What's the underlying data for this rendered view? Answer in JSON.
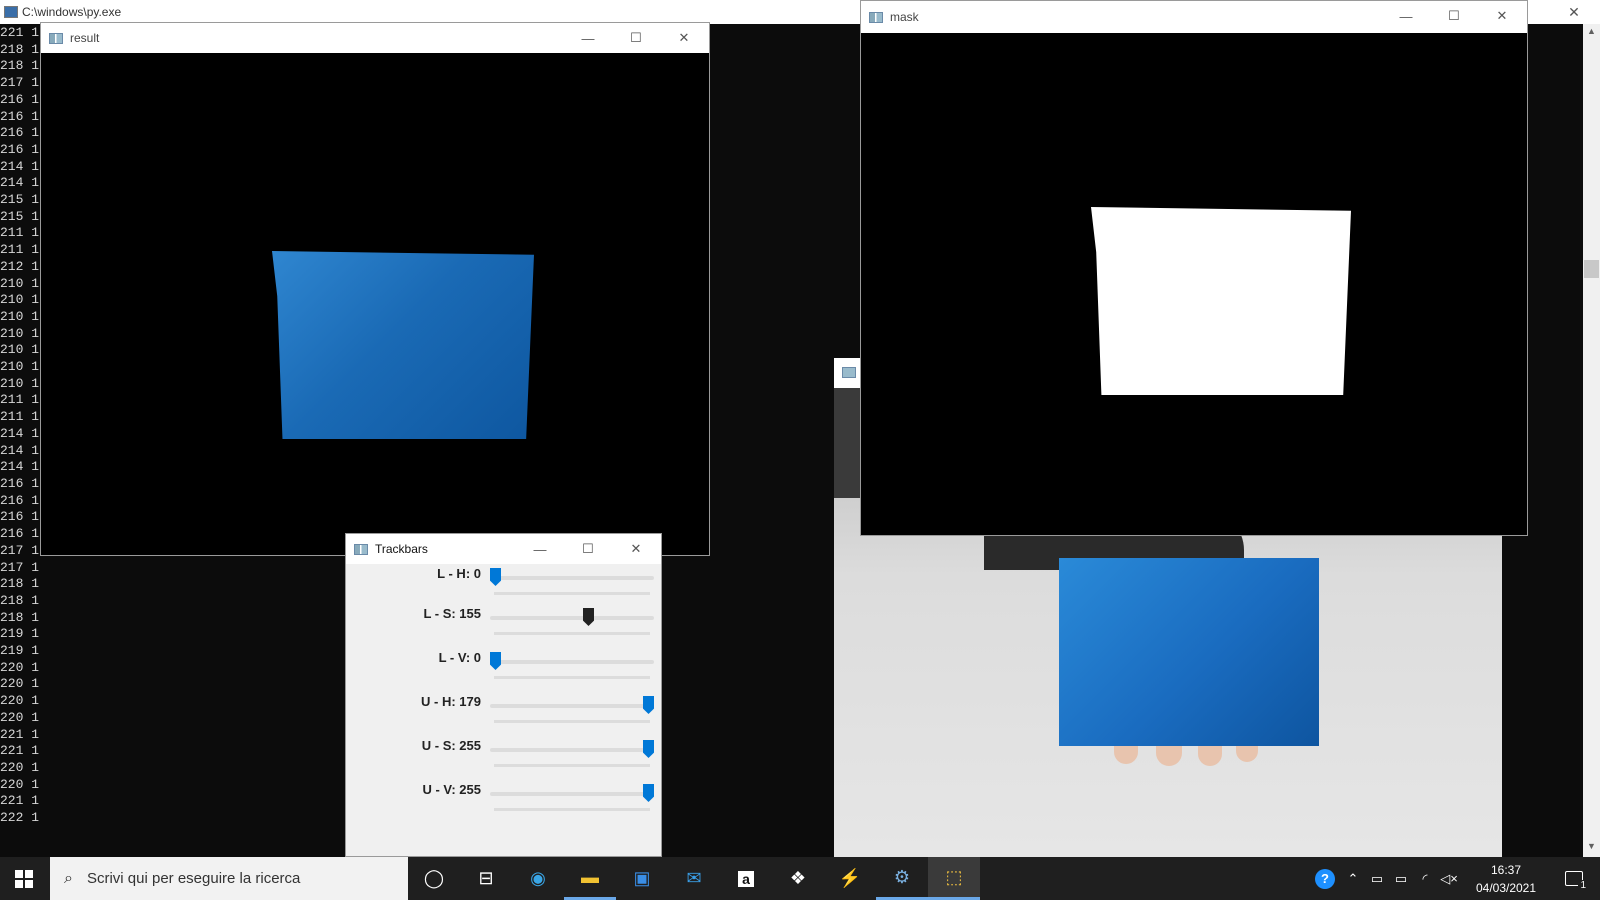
{
  "console": {
    "title": "C:\\windows\\py.exe",
    "close_glyph": "✕",
    "lines": [
      "221 1",
      "218 1",
      "218 1",
      "217 1",
      "216 1",
      "216 1",
      "216 1",
      "216 1",
      "214 1",
      "214 1",
      "215 1",
      "215 1",
      "211 1",
      "211 1",
      "212 1",
      "210 1",
      "210 1",
      "210 1",
      "210 1",
      "210 1",
      "210 1",
      "210 1",
      "211 1",
      "211 1",
      "214 1",
      "214 1",
      "214 1",
      "216 1",
      "216 1",
      "216 1",
      "216 1",
      "217 1",
      "217 1",
      "218 1",
      "218 1",
      "218 1",
      "219 1",
      "219 1",
      "220 1",
      "220 1",
      "220 1",
      "220 1",
      "221 1",
      "221 1",
      "220 1",
      "220 1",
      "221 1",
      "222 1"
    ]
  },
  "windows": {
    "result": {
      "title": "result"
    },
    "mask": {
      "title": "mask"
    },
    "trackbars": {
      "title": "Trackbars"
    }
  },
  "window_controls": {
    "minimize": "—",
    "maximize": "☐",
    "close": "✕"
  },
  "trackbars": [
    {
      "label": "L - H: 0",
      "value": 0,
      "max": 179
    },
    {
      "label": "L - S: 155",
      "value": 155,
      "max": 255
    },
    {
      "label": "L - V: 0",
      "value": 0,
      "max": 255
    },
    {
      "label": "U - H: 179",
      "value": 179,
      "max": 179
    },
    {
      "label": "U - S: 255",
      "value": 255,
      "max": 255
    },
    {
      "label": "U - V: 255",
      "value": 255,
      "max": 255
    }
  ],
  "taskbar": {
    "search_placeholder": "Scrivi qui per eseguire la ricerca",
    "time": "16:37",
    "date": "04/03/2021",
    "notification_count": "1",
    "icons": [
      "cortana-icon",
      "task-view-icon",
      "edge-icon",
      "file-explorer-icon",
      "store-icon",
      "mail-icon",
      "amazon-icon",
      "dropbox-icon",
      "sword-app-icon",
      "python-idle-icon",
      "python-icon"
    ]
  },
  "colors": {
    "accent": "#0078d7",
    "taskbar": "#1f1f1f",
    "console_bg": "#0c0c0c"
  }
}
